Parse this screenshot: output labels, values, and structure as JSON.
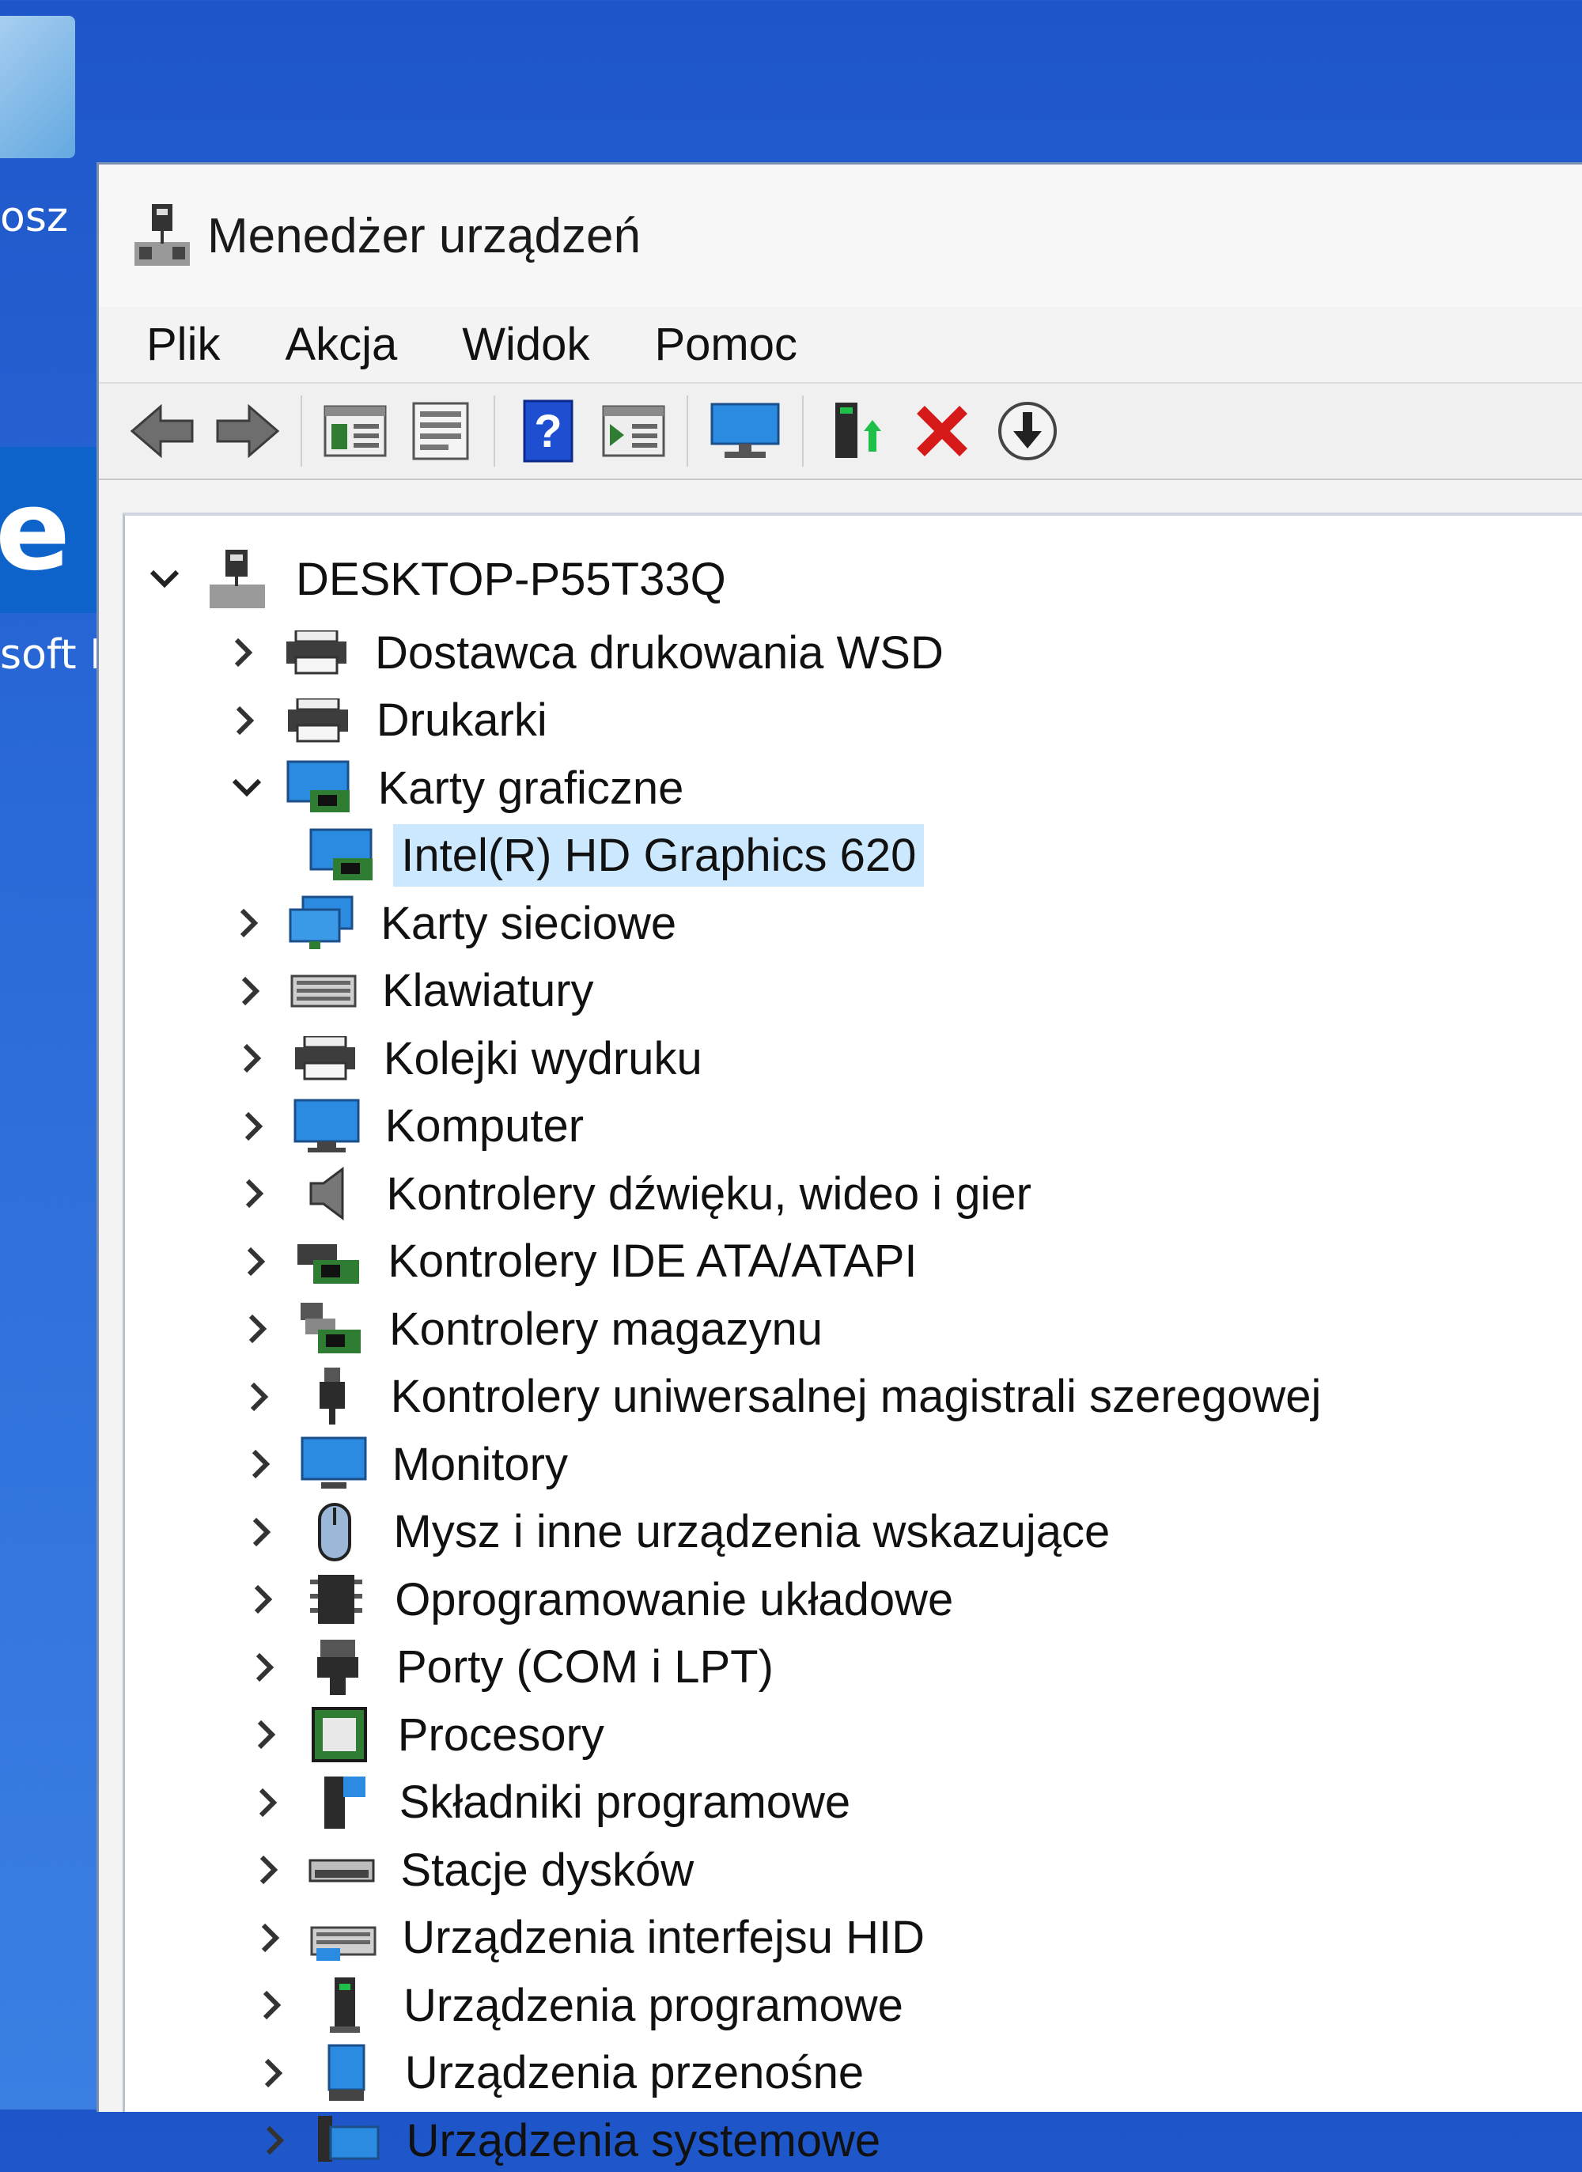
{
  "desktop": {
    "label_top": "osz",
    "label_bottom": "soft E"
  },
  "window": {
    "title": "Menedżer urządzeń"
  },
  "menu": [
    "Plik",
    "Akcja",
    "Widok",
    "Pomoc"
  ],
  "toolbar": {
    "buttons": [
      "back-arrow-icon",
      "forward-arrow-icon",
      "show-hide-tree-icon",
      "properties-icon",
      "help-icon",
      "run-icon",
      "scan-hardware-icon",
      "update-driver-icon",
      "uninstall-icon",
      "download-icon"
    ],
    "colors": {
      "uninstall": "#d61a1a",
      "help": "#1f4fd1",
      "monitor": "#2a8be0"
    }
  },
  "tree": {
    "root": "DESKTOP-P55T33Q",
    "items": [
      {
        "label": "Dostawca drukowania WSD",
        "icon": "printer-icon",
        "expanded": false
      },
      {
        "label": "Drukarki",
        "icon": "printer-icon",
        "expanded": false
      },
      {
        "label": "Karty graficzne",
        "icon": "display-adapter-icon",
        "expanded": true
      },
      {
        "label": "Intel(R) HD Graphics 620",
        "icon": "display-adapter-icon",
        "child": true,
        "selected": true
      },
      {
        "label": "Karty sieciowe",
        "icon": "network-icon",
        "expanded": false
      },
      {
        "label": "Klawiatury",
        "icon": "keyboard-icon",
        "expanded": false
      },
      {
        "label": "Kolejki wydruku",
        "icon": "printer-icon",
        "expanded": false
      },
      {
        "label": "Komputer",
        "icon": "computer-icon",
        "expanded": false
      },
      {
        "label": "Kontrolery dźwięku, wideo i gier",
        "icon": "speaker-icon",
        "expanded": false
      },
      {
        "label": "Kontrolery IDE ATA/ATAPI",
        "icon": "ide-controller-icon",
        "expanded": false
      },
      {
        "label": "Kontrolery magazynu",
        "icon": "storage-controller-icon",
        "expanded": false
      },
      {
        "label": "Kontrolery uniwersalnej magistrali szeregowej",
        "icon": "usb-icon",
        "expanded": false
      },
      {
        "label": "Monitory",
        "icon": "monitor-icon",
        "expanded": false
      },
      {
        "label": "Mysz i inne urządzenia wskazujące",
        "icon": "mouse-icon",
        "expanded": false
      },
      {
        "label": "Oprogramowanie układowe",
        "icon": "firmware-chip-icon",
        "expanded": false
      },
      {
        "label": "Porty (COM i LPT)",
        "icon": "port-icon",
        "expanded": false
      },
      {
        "label": "Procesory",
        "icon": "processor-icon",
        "expanded": false
      },
      {
        "label": "Składniki programowe",
        "icon": "software-component-icon",
        "expanded": false
      },
      {
        "label": "Stacje dysków",
        "icon": "disk-drive-icon",
        "expanded": false
      },
      {
        "label": "Urządzenia interfejsu HID",
        "icon": "hid-icon",
        "expanded": false
      },
      {
        "label": "Urządzenia programowe",
        "icon": "software-device-icon",
        "expanded": false
      },
      {
        "label": "Urządzenia przenośne",
        "icon": "portable-device-icon",
        "expanded": false
      },
      {
        "label": "Urządzenia systemowe",
        "icon": "system-device-icon",
        "expanded": false
      }
    ]
  }
}
